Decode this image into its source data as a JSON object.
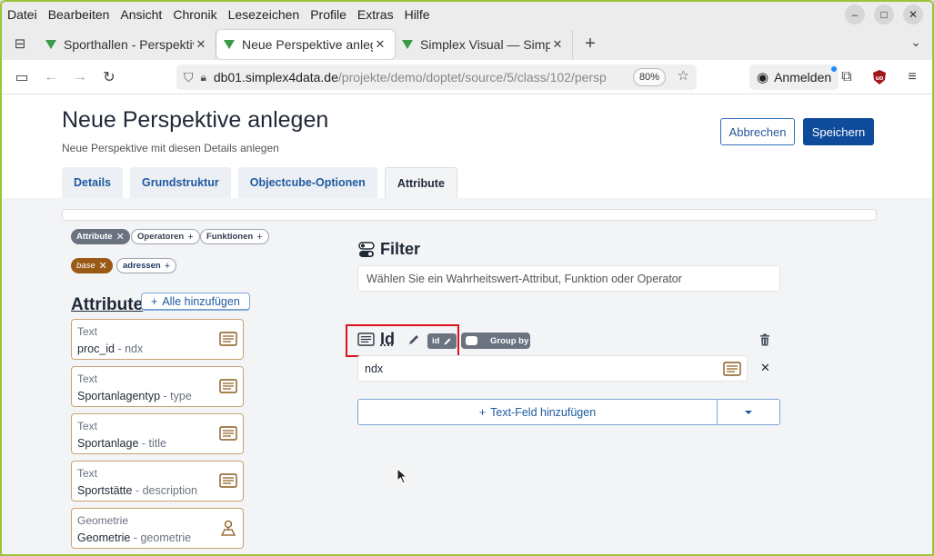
{
  "menubar": {
    "items": [
      "Datei",
      "Bearbeiten",
      "Ansicht",
      "Chronik",
      "Lesezeichen",
      "Profile",
      "Extras",
      "Hilfe"
    ]
  },
  "tabs": [
    {
      "title": "Sporthallen - Perspektiven",
      "active": false
    },
    {
      "title": "Neue Perspektive anlegen",
      "active": true
    },
    {
      "title": "Simplex Visual — Simplex",
      "active": false
    }
  ],
  "navbar": {
    "url_host": "db01.simplex4data.de",
    "url_path": "/projekte/demo/doptet/source/5/class/102/persp",
    "zoom": "80%",
    "signin_label": "Anmelden"
  },
  "page": {
    "title": "Neue Perspektive anlegen",
    "subtitle": "Neue Perspektive mit diesen Details anlegen",
    "cancel_label": "Abbrechen",
    "save_label": "Speichern",
    "tabs": [
      "Details",
      "Grundstruktur",
      "Objectcube-Optionen",
      "Attribute"
    ],
    "active_tab": "Attribute"
  },
  "chips": {
    "attribute": "Attribute",
    "operatoren": "Operatoren",
    "funktionen": "Funktionen",
    "base": "base",
    "adressen": "adressen"
  },
  "attributes": {
    "heading": "Attribute",
    "add_all_label": "Alle hinzufügen",
    "items": [
      {
        "type": "Text",
        "name": "proc_id",
        "key": "ndx",
        "icon": "text-lines-icon"
      },
      {
        "type": "Text",
        "name": "Sportanlagentyp",
        "key": "type",
        "icon": "text-lines-icon"
      },
      {
        "type": "Text",
        "name": "Sportanlage",
        "key": "title",
        "icon": "text-lines-icon"
      },
      {
        "type": "Text",
        "name": "Sportstätte",
        "key": "description",
        "icon": "text-lines-icon"
      },
      {
        "type": "Geometrie",
        "name": "Geometrie",
        "key": "geometrie",
        "icon": "location-person-icon"
      }
    ]
  },
  "filter": {
    "title": "Filter",
    "placeholder": "Wählen Sie ein Wahrheitswert-Attribut, Funktion oder Operator"
  },
  "field": {
    "name": "Id",
    "badge": "id",
    "group_by_label": "Group by",
    "value": "ndx",
    "add_text_field_label": "Text-Feld hinzufügen"
  },
  "colors": {
    "primary": "#0e4b9a",
    "highlight_box": "#d9141b",
    "attribute_border": "#c8a373",
    "chip_dark": "#6b7280",
    "chip_brown": "#9a5a15"
  }
}
